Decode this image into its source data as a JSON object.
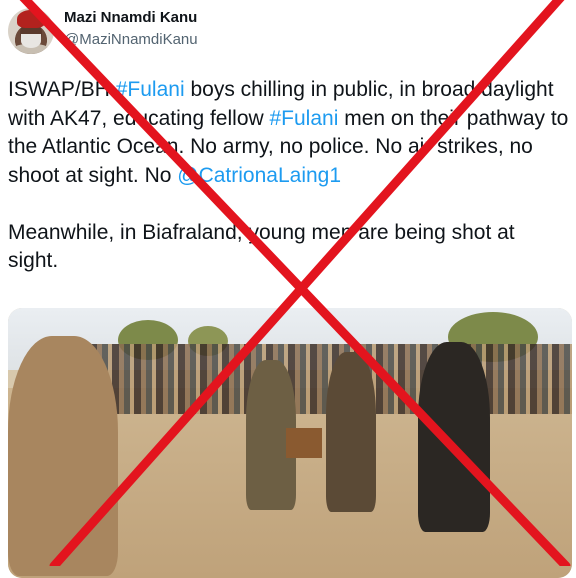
{
  "author": {
    "display_name": "Mazi Nnamdi Kanu",
    "handle": "@MaziNnamdiKanu"
  },
  "tweet": {
    "segments_line1": [
      {
        "text": "ISWAP/BH ",
        "type": "text"
      },
      {
        "text": "#Fulani",
        "type": "hashtag"
      },
      {
        "text": " boys chilling in public, in broad daylight with AK47, educating fellow ",
        "type": "text"
      },
      {
        "text": "#Fulani",
        "type": "hashtag"
      },
      {
        "text": " men on their pathway to the Atlantic Ocean. No army, no police. No air strikes, no shoot at sight. No ",
        "type": "text"
      },
      {
        "text": "@CatrionaLaing1",
        "type": "mention"
      }
    ],
    "paragraph2": "Meanwhile, in Biafraland, young men are being shot at sight."
  },
  "colors": {
    "link": "#1d9bf0",
    "cross": "#e3141e"
  }
}
